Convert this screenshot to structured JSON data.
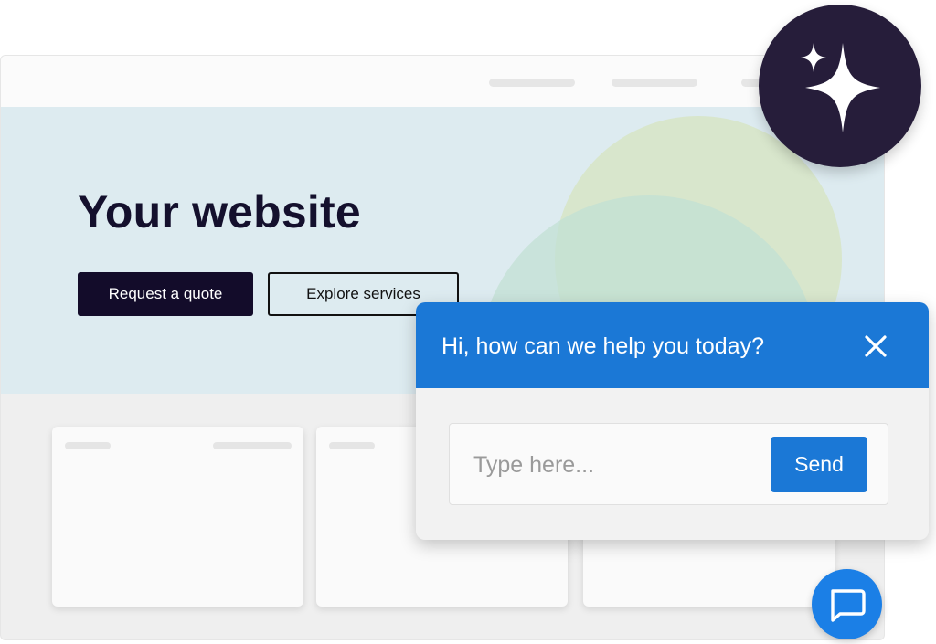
{
  "site": {
    "hero": {
      "title": "Your website",
      "primary_button": "Request a quote",
      "secondary_button": "Explore services"
    }
  },
  "chat": {
    "title": "Hi, how can we help you today?",
    "input_placeholder": "Type here...",
    "send_label": "Send",
    "close_icon": "close-icon"
  },
  "icons": {
    "badge": "sparkle-icon",
    "launcher": "chat-bubble-icon"
  },
  "colors": {
    "accent": "#1b78d6",
    "launcher": "#1b7fe6",
    "dark": "#130c2a",
    "badge": "#261d3a",
    "hero_bg": "#ddebf0"
  }
}
